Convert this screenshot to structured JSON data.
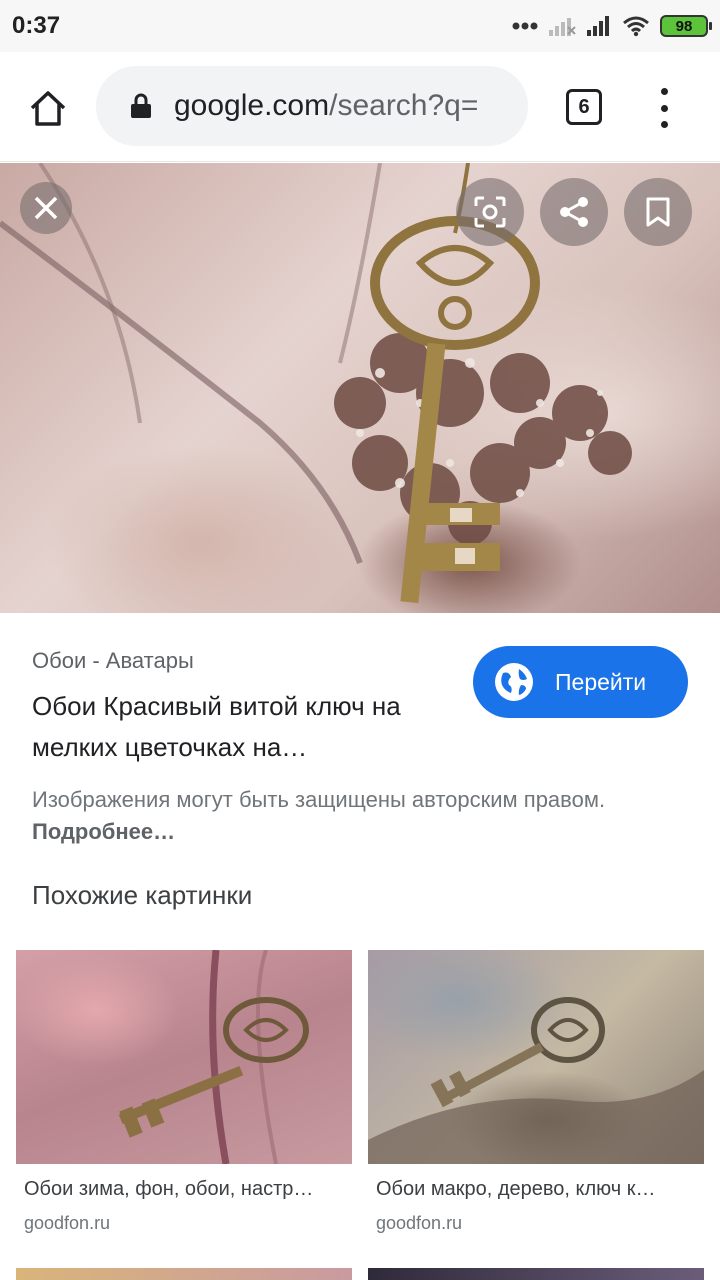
{
  "status_bar": {
    "time": "0:37",
    "battery": "98"
  },
  "toolbar": {
    "url_domain": "google.com",
    "url_path": "/search?q=",
    "tab_count": "6"
  },
  "result": {
    "source": "Обои - Аватары",
    "title": "Обои Красивый витой ключ на мелких цветочках на…",
    "goto_label": "Перейти",
    "copyright_text": "Изображения могут быть защищены авторским правом.",
    "more_link": "Подробнее…"
  },
  "similar": {
    "heading": "Похожие картинки",
    "items": [
      {
        "title": "Обои зима, фон, обои, настр…",
        "domain": "goodfon.ru"
      },
      {
        "title": "Обои макро, дерево, ключ к…",
        "domain": "goodfon.ru"
      }
    ]
  },
  "colors": {
    "accent": "#1a73e8",
    "battery": "#5cc43a"
  },
  "icons": [
    "home-icon",
    "lock-icon",
    "menu-icon",
    "close-icon",
    "lens-icon",
    "share-icon",
    "bookmark-icon",
    "globe-icon"
  ]
}
